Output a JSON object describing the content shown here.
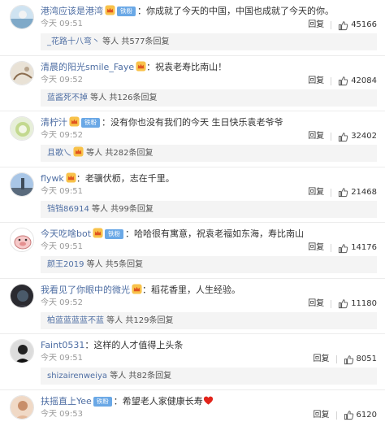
{
  "ui": {
    "reply_label": "回复",
    "fan_badge": "铁粉",
    "colon": "："
  },
  "comments": [
    {
      "user": "港湾应该是港湾",
      "crown": true,
      "fan": true,
      "text": "你成就了今天的中国，中国也成就了今天的你。",
      "time": "今天 09:51",
      "likes": "45166",
      "sub_user": "_花路十八弯丶",
      "sub_crown": false,
      "sub_text": " 等人 共577条回复"
    },
    {
      "user": "清晨的阳光smile_Faye",
      "crown": true,
      "fan": false,
      "text": "祝袁老寿比南山！",
      "time": "今天 09:52",
      "likes": "42084",
      "sub_user": "蓝酱死不掉",
      "sub_crown": false,
      "sub_text": " 等人 共126条回复"
    },
    {
      "user": "清柠汁",
      "crown": true,
      "fan": true,
      "text": "没有你也没有我们的今天  生日快乐袁老爷爷",
      "time": "今天 09:52",
      "likes": "32402",
      "sub_user": "且歌乀",
      "sub_crown": true,
      "sub_text": " 等人 共282条回复"
    },
    {
      "user": "flywk",
      "crown": true,
      "fan": false,
      "text": "老骥伏枥，志在千里。",
      "time": "今天 09:51",
      "likes": "21468",
      "sub_user": "铛铛86914",
      "sub_crown": false,
      "sub_text": " 等人 共99条回复"
    },
    {
      "user": "今天吃啥bot",
      "crown": true,
      "fan": true,
      "text": "哈哈很有寓意，祝袁老福如东海，寿比南山",
      "time": "今天 09:51",
      "likes": "14176",
      "sub_user": "颜王2019",
      "sub_crown": false,
      "sub_text": " 等人 共5条回复"
    },
    {
      "user": "我看见了你眼中的微光",
      "crown": true,
      "fan": false,
      "text": "稻花香里，人生经验。",
      "time": "今天 09:52",
      "likes": "11180",
      "sub_user": "柏蓝蓝蓝蓝不蓝",
      "sub_crown": false,
      "sub_text": " 等人 共129条回复"
    },
    {
      "user": "Faint0531",
      "crown": false,
      "fan": false,
      "text": "这样的人才值得上头条",
      "time": "今天 09:51",
      "likes": "8051",
      "sub_user": "shizairenweiya",
      "sub_crown": false,
      "sub_text": " 等人 共82条回复"
    },
    {
      "user": "扶摇直上Yee",
      "crown": false,
      "fan": true,
      "text": "希望老人家健康长寿",
      "time": "今天 09:53",
      "likes": "6120",
      "sub_user": "",
      "sub_crown": false,
      "sub_text": ""
    }
  ],
  "icons": {
    "thumb": "thumbs-up-icon",
    "crown": "crown-icon",
    "heart": "heart-icon"
  },
  "colors": {
    "username": "#4e6ea3",
    "fan_badge": "#6aa8e6",
    "heart": "#e2241b"
  }
}
